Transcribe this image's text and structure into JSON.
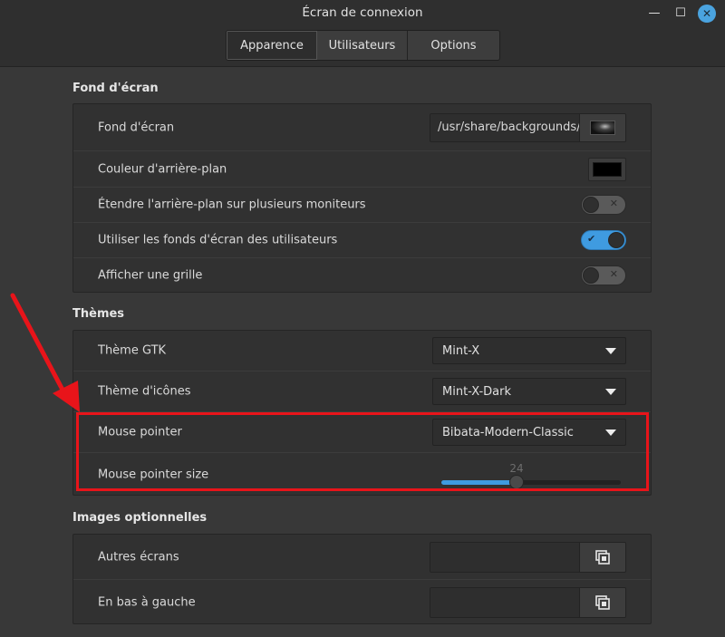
{
  "window": {
    "title": "Écran de connexion",
    "controls": {
      "minimize_icon": "minimize-icon",
      "maximize_icon": "maximize-icon",
      "close_icon": "close-icon"
    }
  },
  "tabs": [
    {
      "label": "Apparence",
      "active": true
    },
    {
      "label": "Utilisateurs",
      "active": false
    },
    {
      "label": "Options",
      "active": false
    }
  ],
  "background": {
    "section_title": "Fond d'écran",
    "wallpaper": {
      "label": "Fond d'écran",
      "value": "/usr/share/backgrounds/"
    },
    "bg_color": {
      "label": "Couleur d'arrière-plan",
      "color": "#000000"
    },
    "stretch": {
      "label": "Étendre l'arrière-plan sur plusieurs moniteurs",
      "on": false
    },
    "user_wallpapers": {
      "label": "Utiliser les fonds d'écran des utilisateurs",
      "on": true
    },
    "grid": {
      "label": "Afficher une grille",
      "on": false
    }
  },
  "themes": {
    "section_title": "Thèmes",
    "gtk": {
      "label": "Thème GTK",
      "value": "Mint-X"
    },
    "icons": {
      "label": "Thème d'icônes",
      "value": "Mint-X-Dark"
    },
    "pointer": {
      "label": "Mouse pointer",
      "value": "Bibata-Modern-Classic"
    },
    "pointer_size": {
      "label": "Mouse pointer size",
      "value": "24",
      "fraction": 0.42
    }
  },
  "optional_images": {
    "section_title": "Images optionnelles",
    "other_screens": {
      "label": "Autres écrans",
      "value": ""
    },
    "bottom_left": {
      "label": "En bas à gauche",
      "value": ""
    }
  },
  "annotation": {
    "color": "#e8141a"
  }
}
